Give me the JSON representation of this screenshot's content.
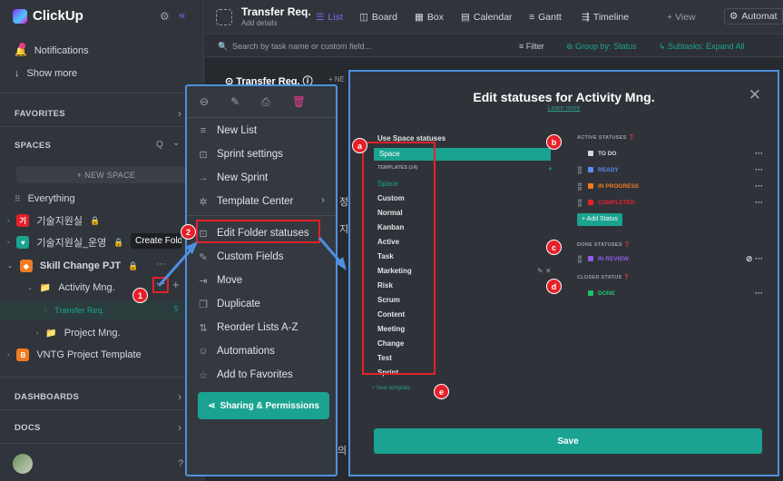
{
  "app": {
    "name": "ClickUp"
  },
  "sidebar": {
    "notifications": "Notifications",
    "show_more": "Show more",
    "favorites": "FAVORITES",
    "spaces": "SPACES",
    "new_space": "+ NEW SPACE",
    "everything": "Everything",
    "items": [
      {
        "label": "기술지원실",
        "letter": "기",
        "color": "#e5202a"
      },
      {
        "label": "기술지원실_운영",
        "letter": "♥",
        "color": "#1aa390"
      },
      {
        "label": "Skill Change PJT",
        "letter": "◆",
        "color": "#f07b22"
      }
    ],
    "folder": "Activity Mng.",
    "list_selected": "Transfer Req.",
    "list_count": "5",
    "project": "Project Mng.",
    "template": "VNTG Project Template",
    "dashboards": "DASHBOARDS",
    "docs": "DOCS",
    "tooltip": "Create Folder"
  },
  "topbar": {
    "title": "Transfer Req.",
    "subtitle": "Add details",
    "views": [
      "List",
      "Board",
      "Box",
      "Calendar",
      "Gantt",
      "Timeline"
    ],
    "add_view": "+ View",
    "automate": "Automat"
  },
  "filterbar": {
    "search_placeholder": "Search by task name or custom field...",
    "filter": "Filter",
    "group_by": "Group by: Status",
    "subtasks": "Subtasks: Expand All"
  },
  "main": {
    "list_header": "Transfer Req.",
    "new_label": "+ NE",
    "fragment_1": "정",
    "fragment_2": "지",
    "fragment_3": "센터의"
  },
  "context_menu": {
    "items": [
      "New List",
      "Sprint settings",
      "New Sprint",
      "Template Center",
      "Edit Folder statuses",
      "Custom Fields",
      "Move",
      "Duplicate",
      "Reorder Lists A-Z",
      "Automations",
      "Add to Favorites"
    ],
    "share": "Sharing & Permissions"
  },
  "modal": {
    "title": "Edit statuses for Activity Mng.",
    "learn_more": "Learn more",
    "use_space": "Use Space statuses",
    "space": "Space",
    "templates_header": "TEMPLATES (14)",
    "templates": [
      "Space",
      "Custom",
      "Normal",
      "Kanban",
      "Active",
      "Task",
      "Marketing",
      "Risk",
      "Scrum",
      "Content",
      "Meeting",
      "Change",
      "Test",
      "Sprint"
    ],
    "new_template": "+ New template",
    "active_header": "ACTIVE STATUSES",
    "active_statuses": [
      {
        "name": "TO DO",
        "color": "#d5d8dc"
      },
      {
        "name": "READY",
        "color": "#5a8dee"
      },
      {
        "name": "IN PROGRESS",
        "color": "#f07b22"
      },
      {
        "name": "COMPLETED",
        "color": "#e5202a"
      }
    ],
    "add_status": "+ Add Status",
    "done_header": "DONE STATUSES",
    "done_status": {
      "name": "IN REVIEW",
      "color": "#8f5be8"
    },
    "closed_header": "CLOSED STATUS",
    "closed_status": {
      "name": "DONE",
      "color": "#1ec26b"
    },
    "save": "Save"
  },
  "annotations": {
    "n1": "1",
    "n2": "2",
    "a": "a",
    "b": "b",
    "c": "c",
    "d": "d",
    "e": "e"
  }
}
